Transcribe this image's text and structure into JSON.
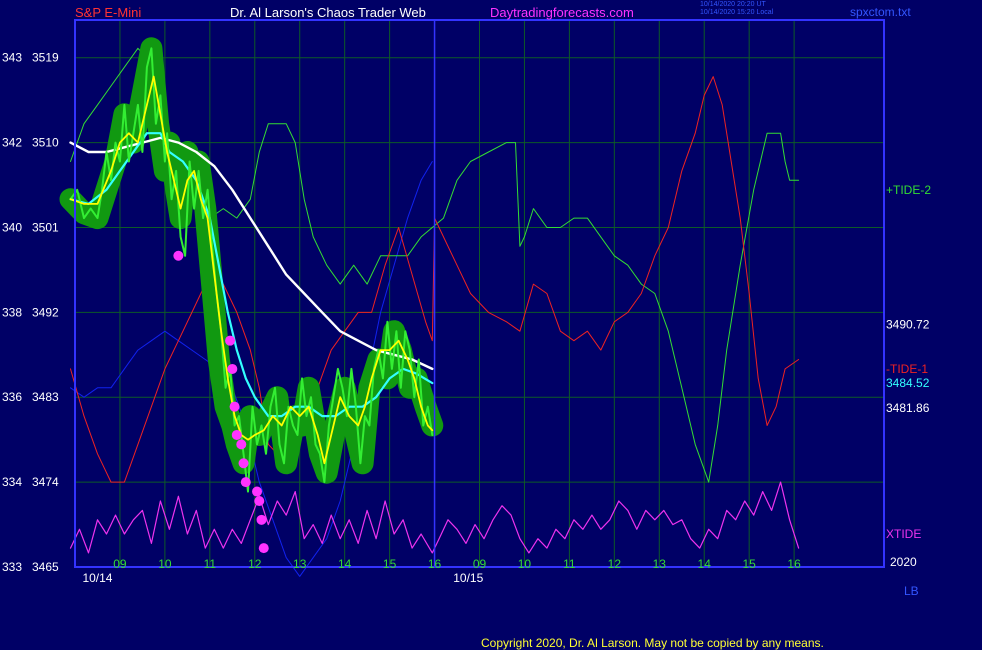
{
  "header": {
    "symbol": "S&P E-Mini",
    "title": "Dr. Al Larson's Chaos Trader Web",
    "site": "Daytradingforecasts.com",
    "stamp1": "10/14/2020 20:20 UT",
    "stamp2": "10/14/2020 15:20 Local",
    "file": "spxctom.txt"
  },
  "footer": {
    "copyright": "Copyright 2020, Dr. Al Larson. May not be copied by any means.",
    "year": "2020",
    "lb": "LB"
  },
  "colors": {
    "background": "#000066",
    "frame": "#3333ff",
    "grid": "#0d5a28",
    "price": "#33ee33",
    "price_glow": "#119911",
    "fast_avg": "#ffff00",
    "mid_avg": "#33ffff",
    "slow_avg": "#ffffff",
    "tide_plus2": "#33dd33",
    "tide_minus1": "#ee2222",
    "xtide": "#ee33ee",
    "blue_line": "#1122ee",
    "marker": "#ff33ff"
  },
  "chart_data": {
    "type": "line",
    "xlim": [
      8,
      26
    ],
    "ylim": [
      3465,
      3523
    ],
    "y_ticks": [
      {
        "value": 3465,
        "left": "333",
        "right": "3465"
      },
      {
        "value": 3474,
        "left": "334",
        "right": "3474"
      },
      {
        "value": 3483,
        "left": "336",
        "right": "3483"
      },
      {
        "value": 3492,
        "left": "338",
        "right": "3492"
      },
      {
        "value": 3501,
        "left": "340",
        "right": "3501"
      },
      {
        "value": 3510,
        "left": "342",
        "right": "3510"
      },
      {
        "value": 3519,
        "left": "343",
        "right": "3519"
      }
    ],
    "x_ticks": [
      {
        "x": 9,
        "label": "09"
      },
      {
        "x": 10,
        "label": "10"
      },
      {
        "x": 11,
        "label": "11"
      },
      {
        "x": 12,
        "label": "12"
      },
      {
        "x": 13,
        "label": "13"
      },
      {
        "x": 14,
        "label": "14"
      },
      {
        "x": 15,
        "label": "15"
      },
      {
        "x": 16,
        "label": "16"
      },
      {
        "x": 17,
        "label": "09"
      },
      {
        "x": 18,
        "label": "10"
      },
      {
        "x": 19,
        "label": "11"
      },
      {
        "x": 20,
        "label": "12"
      },
      {
        "x": 21,
        "label": "13"
      },
      {
        "x": 22,
        "label": "14"
      },
      {
        "x": 23,
        "label": "15"
      },
      {
        "x": 24,
        "label": "16"
      }
    ],
    "day_labels": [
      {
        "x": 8.5,
        "label": "10/14"
      },
      {
        "x": 16.75,
        "label": "10/15"
      }
    ],
    "day_divider_x": 16,
    "right_labels": [
      {
        "label": "+TIDE-2",
        "y": 3505,
        "color_key": "tide_plus2"
      },
      {
        "label": "3490.72",
        "y": 3490.72,
        "color_key": "slow_avg"
      },
      {
        "label": "-TIDE-1",
        "y": 3486,
        "color_key": "tide_minus1"
      },
      {
        "label": "3484.52",
        "y": 3484.52,
        "color_key": "mid_avg"
      },
      {
        "label": "3481.86",
        "y": 3481.86,
        "color_key": "slow_avg"
      },
      {
        "label": "XTIDE",
        "y": 3468.5,
        "color_key": "xtide"
      }
    ],
    "series": [
      {
        "key": "price_glow",
        "color_key": "price_glow",
        "x": [
          7.9,
          8.2,
          8.5,
          8.7,
          8.9,
          9.1,
          9.3,
          9.5,
          9.7,
          9.85,
          10.0,
          10.1,
          10.25,
          10.35,
          10.5,
          10.6,
          10.75,
          10.9,
          11.05,
          11.2,
          11.35,
          11.5,
          11.6,
          11.75,
          11.9,
          12.1,
          12.3,
          12.5,
          12.7,
          12.9,
          13.05,
          13.2,
          13.45,
          13.6,
          13.8,
          14.0,
          14.2,
          14.4,
          14.55,
          14.75,
          14.95,
          15.1,
          15.25,
          15.45,
          15.6,
          15.8,
          15.95
        ],
        "y": [
          3504,
          3502.5,
          3502,
          3505,
          3508,
          3513,
          3510,
          3515,
          3520,
          3512,
          3507,
          3510,
          3505,
          3502,
          3509,
          3505,
          3508,
          3503,
          3495,
          3487,
          3482,
          3480,
          3478,
          3476,
          3481,
          3479,
          3481,
          3483,
          3476,
          3481,
          3480,
          3484,
          3477,
          3475,
          3480,
          3484,
          3480,
          3476,
          3484,
          3487,
          3485,
          3490,
          3488,
          3484,
          3485,
          3482,
          3480
        ]
      },
      {
        "key": "price",
        "color_key": "price",
        "x": [
          7.9,
          8.05,
          8.2,
          8.35,
          8.5,
          8.6,
          8.7,
          8.8,
          8.9,
          9.0,
          9.1,
          9.2,
          9.3,
          9.4,
          9.5,
          9.6,
          9.7,
          9.8,
          9.9,
          10.0,
          10.05,
          10.15,
          10.25,
          10.35,
          10.45,
          10.55,
          10.65,
          10.75,
          10.85,
          10.95,
          11.05,
          11.15,
          11.25,
          11.35,
          11.45,
          11.55,
          11.65,
          11.75,
          11.85,
          11.95,
          12.05,
          12.15,
          12.25,
          12.35,
          12.45,
          12.55,
          12.65,
          12.75,
          12.85,
          12.95,
          13.05,
          13.15,
          13.25,
          13.35,
          13.45,
          13.55,
          13.65,
          13.75,
          13.85,
          13.95,
          14.05,
          14.15,
          14.25,
          14.35,
          14.45,
          14.55,
          14.65,
          14.75,
          14.85,
          14.95,
          15.05,
          15.15,
          15.25,
          15.35,
          15.45,
          15.55,
          15.65,
          15.75,
          15.85,
          15.95
        ],
        "y": [
          3504,
          3505,
          3502,
          3503,
          3502,
          3505,
          3509,
          3506,
          3510,
          3508,
          3514,
          3508,
          3511,
          3514,
          3509,
          3518,
          3520,
          3512,
          3515,
          3508,
          3511,
          3504,
          3507,
          3500,
          3498,
          3508,
          3503,
          3507,
          3502,
          3505,
          3499,
          3494,
          3490,
          3484,
          3486,
          3480,
          3481,
          3477,
          3473,
          3482,
          3478,
          3480,
          3477,
          3482,
          3484,
          3478,
          3476,
          3482,
          3480,
          3479,
          3485,
          3481,
          3483,
          3478,
          3477,
          3474,
          3480,
          3483,
          3486,
          3484,
          3481,
          3486,
          3482,
          3476,
          3481,
          3480,
          3486,
          3488,
          3485,
          3491,
          3486,
          3490,
          3484,
          3490,
          3488,
          3483,
          3487,
          3480,
          3482,
          3479
        ]
      },
      {
        "key": "fast_avg",
        "color_key": "fast_avg",
        "x": [
          7.9,
          8.2,
          8.5,
          8.8,
          9.0,
          9.2,
          9.4,
          9.6,
          9.75,
          9.9,
          10.05,
          10.2,
          10.35,
          10.5,
          10.65,
          10.8,
          10.95,
          11.1,
          11.25,
          11.4,
          11.55,
          11.7,
          11.85,
          12.0,
          12.2,
          12.4,
          12.6,
          12.8,
          13.0,
          13.2,
          13.4,
          13.55,
          13.7,
          13.9,
          14.1,
          14.3,
          14.45,
          14.6,
          14.8,
          15.0,
          15.2,
          15.4,
          15.55,
          15.7,
          15.85,
          15.95
        ],
        "y": [
          3504,
          3503.5,
          3503.5,
          3507,
          3510,
          3511,
          3510,
          3514,
          3517,
          3513,
          3509,
          3506,
          3503,
          3506,
          3507,
          3504,
          3502,
          3496,
          3490,
          3485,
          3481,
          3479,
          3478.5,
          3479,
          3479.5,
          3481,
          3480,
          3482,
          3481,
          3482,
          3479,
          3476,
          3479,
          3483,
          3481,
          3480,
          3482,
          3485,
          3488,
          3488,
          3489,
          3487,
          3485,
          3482,
          3480,
          3479.5
        ]
      },
      {
        "key": "mid_avg",
        "color_key": "mid_avg",
        "x": [
          7.9,
          8.3,
          8.7,
          9.0,
          9.3,
          9.6,
          9.9,
          10.1,
          10.4,
          10.7,
          11.0,
          11.2,
          11.4,
          11.6,
          11.8,
          12.0,
          12.3,
          12.6,
          12.9,
          13.2,
          13.5,
          13.8,
          14.1,
          14.4,
          14.7,
          15.0,
          15.3,
          15.6,
          15.95
        ],
        "y": [
          3504,
          3503.5,
          3505,
          3507,
          3509,
          3511,
          3511,
          3509,
          3508,
          3506,
          3502,
          3497,
          3492,
          3488,
          3485,
          3483,
          3481,
          3481,
          3482,
          3482,
          3481,
          3481,
          3482,
          3482,
          3483,
          3485,
          3486,
          3485.5,
          3484.5
        ]
      },
      {
        "key": "slow_avg",
        "color_key": "slow_avg",
        "x": [
          7.9,
          8.3,
          8.7,
          9.1,
          9.5,
          9.9,
          10.3,
          10.7,
          11.1,
          11.5,
          11.9,
          12.3,
          12.7,
          13.1,
          13.5,
          13.9,
          14.3,
          14.7,
          15.1,
          15.5,
          15.95
        ],
        "y": [
          3510,
          3509,
          3509,
          3509.5,
          3510,
          3510.5,
          3510,
          3509,
          3507.5,
          3505,
          3502,
          3499,
          3496,
          3494,
          3492,
          3490,
          3489,
          3488,
          3487.5,
          3487,
          3486
        ]
      },
      {
        "key": "tide_plus2",
        "color_key": "tide_plus2",
        "x": [
          7.9,
          8.2,
          8.5,
          8.8,
          9.1,
          9.4,
          9.6,
          9.75,
          9.9,
          10.1,
          10.4,
          10.7,
          11.0,
          11.3,
          11.6,
          11.9,
          12.1,
          12.3,
          12.5,
          12.7,
          12.9,
          13.1,
          13.3,
          13.6,
          13.9,
          14.2,
          14.5,
          14.8,
          15.1,
          15.4,
          15.7,
          15.95,
          16.2,
          16.5,
          16.8,
          17.2,
          17.6,
          17.8,
          17.9,
          18.0,
          18.2,
          18.5,
          18.8,
          19.1,
          19.4,
          19.7,
          20.0,
          20.3,
          20.6,
          20.9,
          21.2,
          21.5,
          21.8,
          22.1,
          22.3,
          22.5,
          22.8,
          23.1,
          23.4,
          23.7,
          23.8,
          23.9,
          24.1
        ],
        "y": [
          3508,
          3512,
          3514,
          3516,
          3518,
          3520,
          3519,
          3513,
          3511,
          3510,
          3506,
          3503,
          3502,
          3503,
          3502,
          3504,
          3509,
          3512,
          3512,
          3512,
          3510,
          3504,
          3500,
          3497,
          3495,
          3497,
          3495,
          3498,
          3498,
          3498,
          3500,
          3501,
          3502,
          3506,
          3508,
          3509,
          3510,
          3510,
          3499,
          3500,
          3503,
          3501,
          3501,
          3502,
          3502,
          3500,
          3498,
          3497,
          3495,
          3494,
          3490,
          3484,
          3478,
          3474,
          3480,
          3488,
          3497,
          3505,
          3511,
          3511,
          3508,
          3506,
          3506
        ]
      },
      {
        "key": "tide_minus1",
        "color_key": "tide_minus1",
        "x": [
          7.9,
          8.2,
          8.5,
          8.8,
          9.1,
          9.4,
          9.7,
          10.0,
          10.3,
          10.6,
          10.9,
          11.1,
          11.3,
          11.6,
          11.9,
          12.1,
          12.3,
          12.5,
          12.7,
          12.9,
          13.1,
          13.4,
          13.7,
          14.0,
          14.3,
          14.6,
          14.9,
          15.2,
          15.5,
          15.8,
          15.95,
          16.0,
          16.2,
          16.5,
          16.8,
          17.2,
          17.6,
          17.9,
          18.2,
          18.5,
          18.8,
          19.1,
          19.4,
          19.7,
          20.0,
          20.3,
          20.6,
          20.9,
          21.2,
          21.5,
          21.8,
          22.0,
          22.2,
          22.4,
          22.6,
          22.8,
          23.0,
          23.2,
          23.4,
          23.6,
          23.8,
          24.1
        ],
        "y": [
          3486,
          3481,
          3477,
          3474,
          3474,
          3478,
          3482,
          3486,
          3489,
          3492,
          3495,
          3496,
          3495,
          3492,
          3488,
          3484,
          3478,
          3477,
          3476,
          3477,
          3481,
          3484,
          3488,
          3490,
          3492,
          3492,
          3497,
          3501,
          3496,
          3491,
          3489,
          3502,
          3500,
          3497,
          3494,
          3492,
          3491,
          3490,
          3495,
          3494,
          3490,
          3489,
          3490,
          3488,
          3491,
          3492,
          3494,
          3498,
          3501,
          3507,
          3511,
          3515,
          3517,
          3514,
          3508,
          3502,
          3494,
          3485,
          3480,
          3482,
          3486,
          3487
        ]
      },
      {
        "key": "blue_line",
        "color_key": "blue_line",
        "x": [
          7.9,
          8.2,
          8.5,
          8.8,
          9.1,
          9.4,
          9.7,
          10.0,
          10.3,
          10.6,
          10.9,
          11.2,
          11.5,
          11.8,
          12.1,
          12.4,
          12.7,
          13.0,
          13.3,
          13.6,
          13.9,
          14.2,
          14.5,
          14.8,
          15.1,
          15.4,
          15.7,
          15.95
        ],
        "y": [
          3484,
          3483,
          3484,
          3484,
          3486,
          3488,
          3489,
          3490,
          3489,
          3488,
          3487,
          3486,
          3484,
          3480,
          3474,
          3470,
          3466,
          3464,
          3466,
          3468,
          3472,
          3478,
          3485,
          3492,
          3497,
          3502,
          3506,
          3508
        ]
      },
      {
        "key": "xtide",
        "color_key": "xtide",
        "x": [
          7.9,
          8.1,
          8.3,
          8.5,
          8.7,
          8.9,
          9.1,
          9.3,
          9.5,
          9.7,
          9.9,
          10.1,
          10.3,
          10.5,
          10.7,
          10.9,
          11.1,
          11.3,
          11.5,
          11.7,
          11.9,
          12.1,
          12.3,
          12.5,
          12.7,
          12.9,
          13.1,
          13.3,
          13.5,
          13.7,
          13.9,
          14.1,
          14.3,
          14.5,
          14.7,
          14.9,
          15.1,
          15.3,
          15.5,
          15.7,
          15.95,
          16.1,
          16.3,
          16.5,
          16.7,
          16.9,
          17.1,
          17.3,
          17.5,
          17.7,
          17.9,
          18.1,
          18.3,
          18.5,
          18.7,
          18.9,
          19.1,
          19.3,
          19.5,
          19.7,
          19.9,
          20.1,
          20.3,
          20.5,
          20.7,
          20.9,
          21.1,
          21.3,
          21.5,
          21.7,
          21.9,
          22.1,
          22.3,
          22.5,
          22.7,
          22.9,
          23.1,
          23.3,
          23.5,
          23.7,
          23.9,
          24.1
        ],
        "y": [
          3467,
          3469,
          3466.5,
          3470,
          3468.5,
          3470.5,
          3468.5,
          3470,
          3471,
          3467.5,
          3472,
          3469,
          3472.5,
          3468.5,
          3471,
          3467,
          3469,
          3467,
          3469,
          3467.5,
          3470,
          3472.5,
          3469.5,
          3472,
          3470.5,
          3473,
          3468,
          3469.5,
          3467.5,
          3470.5,
          3468,
          3470,
          3467.5,
          3471,
          3468,
          3472,
          3468.5,
          3470,
          3467,
          3468.5,
          3466.5,
          3468,
          3470,
          3469,
          3467.5,
          3469.5,
          3468,
          3470,
          3471.5,
          3470.5,
          3468,
          3466.5,
          3468,
          3467,
          3469,
          3468,
          3470,
          3469,
          3470.5,
          3469,
          3470,
          3472,
          3471,
          3469,
          3471,
          3470,
          3471,
          3469.5,
          3470,
          3468,
          3467,
          3469,
          3468,
          3471,
          3470,
          3472,
          3470.5,
          3473,
          3471,
          3474,
          3470,
          3467
        ]
      },
      {
        "key": "markers",
        "color_key": "marker",
        "x": [
          10.3,
          11.45,
          11.5,
          11.55,
          11.6,
          11.7,
          11.75,
          11.8,
          12.05,
          12.1,
          12.15,
          12.2
        ],
        "y": [
          3498,
          3489,
          3486,
          3482,
          3479,
          3478,
          3476,
          3474,
          3473,
          3472,
          3470,
          3467
        ]
      }
    ]
  }
}
